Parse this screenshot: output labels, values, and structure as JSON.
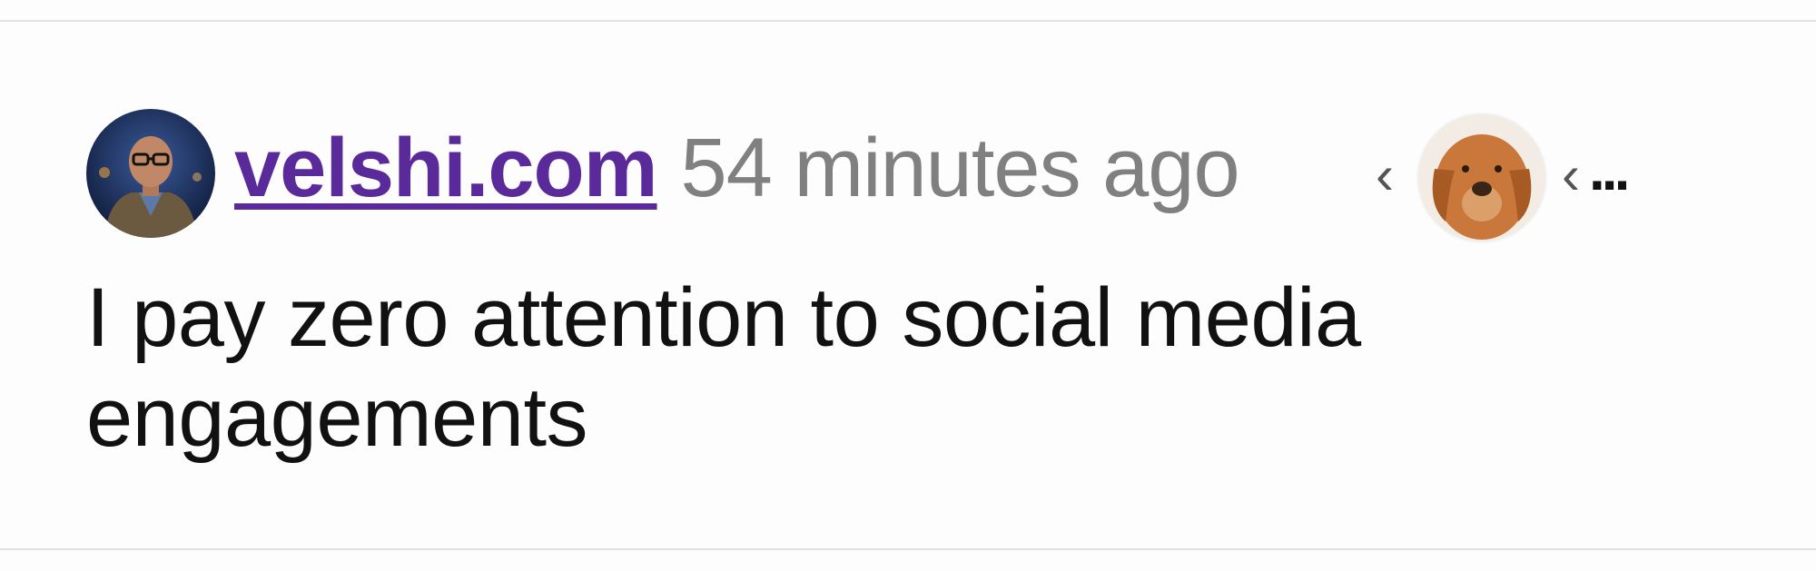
{
  "post": {
    "author_site": "velshi.com",
    "timestamp": "54 minutes ago",
    "text": "I pay zero attention to social media engagements"
  },
  "controls": {
    "prev_symbol": "‹",
    "next_symbol": "‹",
    "more_symbol": "..."
  },
  "icons": {
    "author_avatar": "man-with-glasses-avatar",
    "second_avatar": "golden-retriever-avatar"
  },
  "colors": {
    "link": "#5a2a9a",
    "timestamp": "#808080",
    "text": "#111111"
  }
}
